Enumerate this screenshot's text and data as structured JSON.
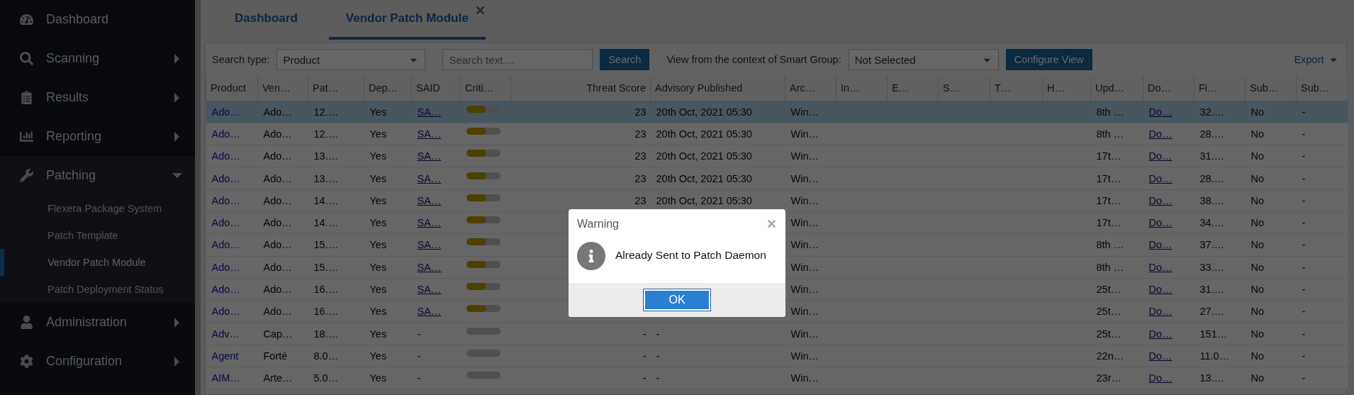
{
  "sidebar": {
    "items": [
      {
        "label": "Dashboard"
      },
      {
        "label": "Scanning",
        "expanded": false
      },
      {
        "label": "Results",
        "expanded": false
      },
      {
        "label": "Reporting",
        "expanded": false
      },
      {
        "label": "Patching",
        "expanded": true,
        "children": [
          {
            "label": "Flexera Package System",
            "selected": false
          },
          {
            "label": "Patch Template",
            "selected": false
          },
          {
            "label": "Vendor Patch Module",
            "selected": true
          },
          {
            "label": "Patch Deployment Status",
            "selected": false
          }
        ]
      },
      {
        "label": "Administration",
        "expanded": false
      },
      {
        "label": "Configuration",
        "expanded": false
      }
    ]
  },
  "tabs": [
    {
      "label": "Dashboard",
      "selected": false
    },
    {
      "label": "Vendor Patch Module",
      "selected": true,
      "close": "✕"
    }
  ],
  "toolbar": {
    "search_type_label": "Search type:",
    "search_type": "Product",
    "search_placeholder": "Search text....",
    "search_button": "Search",
    "context_label": "View from the context of Smart Group:",
    "smart_group": "Not Selected",
    "configure_button": "Configure View",
    "export": "Export"
  },
  "table": {
    "columns": [
      {
        "label": "Product",
        "kind": "link"
      },
      {
        "label": "Ven…",
        "kind": "text"
      },
      {
        "label": "Pat…",
        "kind": "text"
      },
      {
        "label": "Dep…",
        "kind": "text"
      },
      {
        "label": "SAID",
        "kind": "ulink"
      },
      {
        "label": "Criti…",
        "kind": "meter"
      },
      {
        "label": "Threat Score",
        "kind": "number"
      },
      {
        "label": "Advisory Published",
        "kind": "text"
      },
      {
        "label": "Arc…",
        "kind": "text"
      },
      {
        "label": "In…",
        "kind": "text"
      },
      {
        "label": "E…",
        "kind": "text"
      },
      {
        "label": "S…",
        "kind": "text"
      },
      {
        "label": "T…",
        "kind": "text"
      },
      {
        "label": "H…",
        "kind": "text"
      },
      {
        "label": "Upd…",
        "kind": "text"
      },
      {
        "label": "Do…",
        "kind": "ulink"
      },
      {
        "label": "Fi…",
        "kind": "text"
      },
      {
        "label": "Sub…",
        "kind": "text"
      },
      {
        "label": "Sub…",
        "kind": "text"
      }
    ],
    "rows": [
      {
        "selected": true,
        "linked": true,
        "product": "Ado…",
        "column_2": "Ado…",
        "column_3": "12.…",
        "column_4": "Yes",
        "said": "SA…",
        "criticality": {
          "level": 0.6
        },
        "threat_score": "23",
        "advisory_published": "20th Oct, 2021 05:30",
        "column_9": "Win…",
        "column_15": "8th …",
        "column_16": "Do…",
        "column_17": "32.…",
        "column_18": "No",
        "column_19": "-"
      },
      {
        "selected": false,
        "linked": true,
        "product": "Ado…",
        "column_2": "Ado…",
        "column_3": "12.…",
        "column_4": "Yes",
        "said": "SA…",
        "criticality": {
          "level": 0.6
        },
        "threat_score": "23",
        "advisory_published": "20th Oct, 2021 05:30",
        "column_9": "Win…",
        "column_15": "8th …",
        "column_16": "Do…",
        "column_17": "28.…",
        "column_18": "No",
        "column_19": "-"
      },
      {
        "selected": false,
        "linked": true,
        "product": "Ado…",
        "column_2": "Ado…",
        "column_3": "13.…",
        "column_4": "Yes",
        "said": "SA…",
        "criticality": {
          "level": 0.6
        },
        "threat_score": "23",
        "advisory_published": "20th Oct, 2021 05:30",
        "column_9": "Win…",
        "column_15": "17t…",
        "column_16": "Do…",
        "column_17": "31.…",
        "column_18": "No",
        "column_19": "-"
      },
      {
        "selected": false,
        "linked": true,
        "product": "Ado…",
        "column_2": "Ado…",
        "column_3": "13.…",
        "column_4": "Yes",
        "said": "SA…",
        "criticality": {
          "level": 0.6
        },
        "threat_score": "23",
        "advisory_published": "20th Oct, 2021 05:30",
        "column_9": "Win…",
        "column_15": "17t…",
        "column_16": "Do…",
        "column_17": "28.…",
        "column_18": "No",
        "column_19": "-"
      },
      {
        "selected": false,
        "linked": true,
        "product": "Ado…",
        "column_2": "Ado…",
        "column_3": "14.…",
        "column_4": "Yes",
        "said": "SA…",
        "criticality": {
          "level": 0.6
        },
        "threat_score": "23",
        "advisory_published": "20th Oct, 2021 05:30",
        "column_9": "Win…",
        "column_15": "17t…",
        "column_16": "Do…",
        "column_17": "38.…",
        "column_18": "No",
        "column_19": "-"
      },
      {
        "selected": false,
        "linked": true,
        "product": "Ado…",
        "column_2": "Ado…",
        "column_3": "14.…",
        "column_4": "Yes",
        "said": "SA…",
        "criticality": {
          "level": 0.6
        },
        "column_9": "Win…",
        "column_15": "17t…",
        "column_16": "Do…",
        "column_17": "34.…",
        "column_18": "No",
        "column_19": "-"
      },
      {
        "selected": false,
        "linked": true,
        "product": "Ado…",
        "column_2": "Ado…",
        "column_3": "15.…",
        "column_4": "Yes",
        "said": "SA…",
        "criticality": {
          "level": 0.6
        },
        "column_9": "Win…",
        "column_15": "8th …",
        "column_16": "Do…",
        "column_17": "37.…",
        "column_18": "No",
        "column_19": "-"
      },
      {
        "selected": false,
        "linked": true,
        "product": "Ado…",
        "column_2": "Ado…",
        "column_3": "15.…",
        "column_4": "Yes",
        "said": "SA…",
        "criticality": {
          "level": 0.6
        },
        "column_9": "Win…",
        "column_15": "8th …",
        "column_16": "Do…",
        "column_17": "33.…",
        "column_18": "No",
        "column_19": "-"
      },
      {
        "selected": false,
        "linked": true,
        "product": "Ado…",
        "column_2": "Ado…",
        "column_3": "16.…",
        "column_4": "Yes",
        "said": "SA…",
        "criticality": {
          "level": 0.6
        },
        "column_9": "Win…",
        "column_15": "25t…",
        "column_16": "Do…",
        "column_17": "31.…",
        "column_18": "No",
        "column_19": "-"
      },
      {
        "selected": false,
        "linked": true,
        "product": "Ado…",
        "column_2": "Ado…",
        "column_3": "16.…",
        "column_4": "Yes",
        "said": "SA…",
        "criticality": {
          "level": 0.6
        },
        "column_9": "Win…",
        "column_15": "25t…",
        "column_16": "Do…",
        "column_17": "27.…",
        "column_18": "No",
        "column_19": "-"
      },
      {
        "selected": false,
        "linked": false,
        "product": "Adv…",
        "column_2": "Cap…",
        "column_3": "18.…",
        "column_4": "Yes",
        "said": "-",
        "threat_score": "-",
        "advisory_published": "-",
        "column_9": "Win…",
        "column_15": "25t…",
        "column_16": "Do…",
        "column_17": "151…",
        "column_18": "No",
        "column_19": "-"
      },
      {
        "selected": false,
        "linked": false,
        "product": "Agent",
        "column_2": "Forté",
        "column_3": "8.0…",
        "column_4": "Yes",
        "said": "-",
        "threat_score": "-",
        "advisory_published": "-",
        "column_9": "Win…",
        "column_15": "22n…",
        "column_16": "Do…",
        "column_17": "11.0…",
        "column_18": "No",
        "column_19": "-"
      },
      {
        "selected": false,
        "linked": false,
        "product": "AIM…",
        "column_2": "Arte…",
        "column_3": "5.0…",
        "column_4": "Yes",
        "said": "-",
        "threat_score": "-",
        "advisory_published": "-",
        "column_9": "Win…",
        "column_15": "23r…",
        "column_16": "Do…",
        "column_17": "13.…",
        "column_18": "No",
        "column_19": "-"
      }
    ]
  },
  "dialog": {
    "title": "Warning",
    "close": "✕",
    "message": "Already Sent to Patch Daemon",
    "ok": "OK"
  }
}
